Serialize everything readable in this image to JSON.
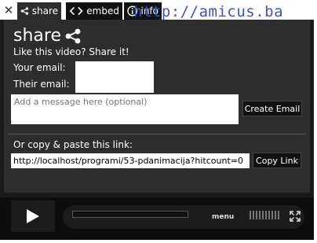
{
  "tabs": [
    {
      "label": "share"
    },
    {
      "label": "embed"
    },
    {
      "label": "info"
    }
  ],
  "watermark": "http://amicus.ba",
  "share": {
    "heading": "share",
    "subtitle": "Like this video? Share it!",
    "your_email_label": "Your email:",
    "your_email_value": "",
    "their_email_label": "Their email:",
    "their_email_value": "",
    "message_placeholder": "Add a message here (optional)",
    "create_email_label": "Create Email",
    "copy_label_text": "Or copy & paste this link:",
    "link_value": "http://localhost/programi/53-pdanimacija?hitcount=0",
    "copy_link_label": "Copy Link"
  },
  "controls": {
    "menu_label": "menu",
    "progress": 0
  },
  "colors": {
    "panel_bg": "#2d2d2d",
    "frame_bg": "#1a1a1a",
    "watermark": "#3d52c9"
  },
  "icons": [
    "close-icon",
    "share-icon",
    "code-icon",
    "info-icon",
    "play-icon",
    "volume-icon",
    "fullscreen-icon"
  ]
}
